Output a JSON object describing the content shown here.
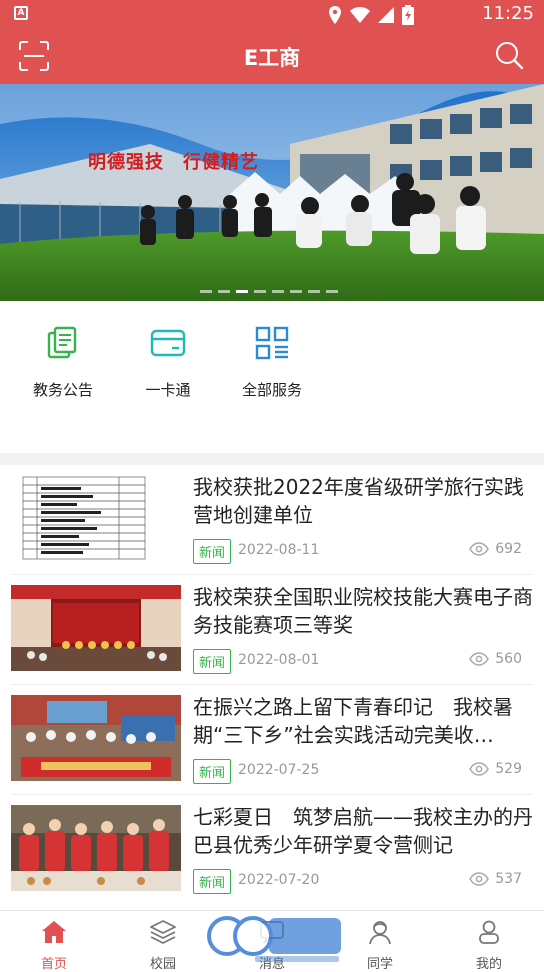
{
  "status_bar": {
    "time": "11:25"
  },
  "app": {
    "title": "E工商"
  },
  "banner": {
    "slogan": "明德强技　行健精艺",
    "slides": 8,
    "active_slide": 3
  },
  "quick_links": [
    {
      "label": "教务公告",
      "icon": "document-icon",
      "color": "#37b24d"
    },
    {
      "label": "一卡通",
      "icon": "card-icon",
      "color": "#1fb9b9"
    },
    {
      "label": "全部服务",
      "icon": "grid-icon",
      "color": "#2a8ad4"
    }
  ],
  "news": [
    {
      "title": "我校获批2022年度省级研学旅行实践营地创建单位",
      "tag": "新闻",
      "date": "2022-08-11",
      "views": "692"
    },
    {
      "title": "我校荣获全国职业院校技能大赛电子商务技能赛项三等奖",
      "tag": "新闻",
      "date": "2022-08-01",
      "views": "560"
    },
    {
      "title": "在振兴之路上留下青春印记　我校暑期“三下乡”社会实践活动完美收…",
      "tag": "新闻",
      "date": "2022-07-25",
      "views": "529"
    },
    {
      "title": "七彩夏日　筑梦启航——我校主办的丹巴县优秀少年研学夏令营侧记",
      "tag": "新闻",
      "date": "2022-07-20",
      "views": "537"
    }
  ],
  "tabs": [
    {
      "label": "首页",
      "icon": "home-icon",
      "active": true
    },
    {
      "label": "校园",
      "icon": "layers-icon",
      "active": false
    },
    {
      "label": "消息",
      "icon": "message-icon",
      "active": false
    },
    {
      "label": "同学",
      "icon": "classmates-icon",
      "active": false
    },
    {
      "label": "我的",
      "icon": "profile-icon",
      "active": false
    }
  ],
  "colors": {
    "brand": "#e05252",
    "tag_green": "#37b24d"
  }
}
